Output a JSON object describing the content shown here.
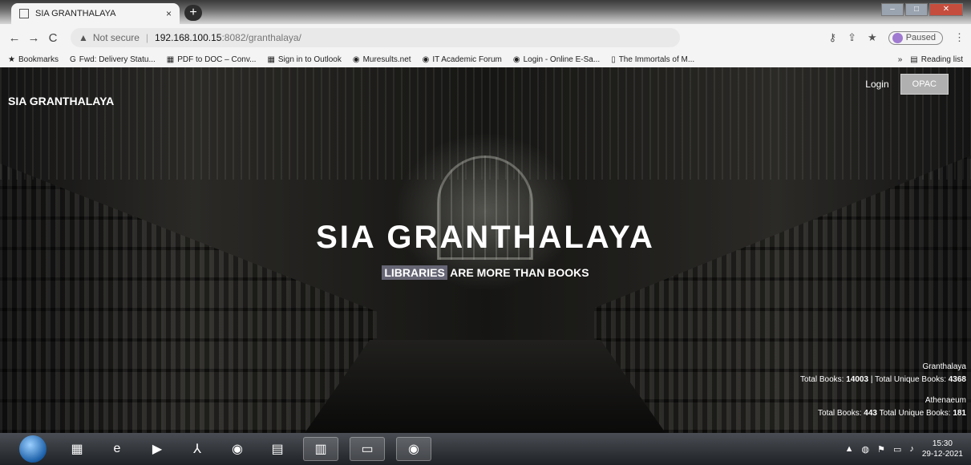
{
  "browser": {
    "tab_title": "SIA GRANTHALAYA",
    "tab_close": "×",
    "new_tab": "+",
    "security_label": "Not secure",
    "url_host": "192.168.100.15",
    "url_path": ":8082/granthalaya/",
    "profile_label": "Paused",
    "reading_list": "Reading list",
    "bookmarks": [
      {
        "label": "Bookmarks",
        "icon": "star-icon"
      },
      {
        "label": "Fwd: Delivery Statu...",
        "icon": "google-icon"
      },
      {
        "label": "PDF to DOC – Conv...",
        "icon": "pdf-icon"
      },
      {
        "label": "Sign in to Outlook",
        "icon": "microsoft-icon"
      },
      {
        "label": "Muresults.net",
        "icon": "globe-icon"
      },
      {
        "label": "IT Academic Forum",
        "icon": "globe-icon"
      },
      {
        "label": "Login - Online E-Sa...",
        "icon": "globe-icon"
      },
      {
        "label": "The Immortals of M...",
        "icon": "bookmark-icon"
      }
    ]
  },
  "site": {
    "brand": "SIA GRANTHALAYA",
    "nav": {
      "login": "Login",
      "opac": "OPAC"
    },
    "hero_title": "SIA GRANTHALAYA",
    "hero_sub_highlight": "LIBRARIES",
    "hero_sub_rest": " ARE MORE THAN BOOKS",
    "stats": [
      {
        "name": "Granthalaya",
        "total_label": "Total Books: ",
        "total": "14003",
        "sep": " | ",
        "unique_label": "Total Unique Books: ",
        "unique": "4368"
      },
      {
        "name": "Athenaeum",
        "total_label": "Total Books: ",
        "total": "443",
        "sep": "   ",
        "unique_label": "Total Unique Books: ",
        "unique": "181"
      }
    ]
  },
  "taskbar": {
    "time": "15:30",
    "date": "29-12-2021"
  }
}
